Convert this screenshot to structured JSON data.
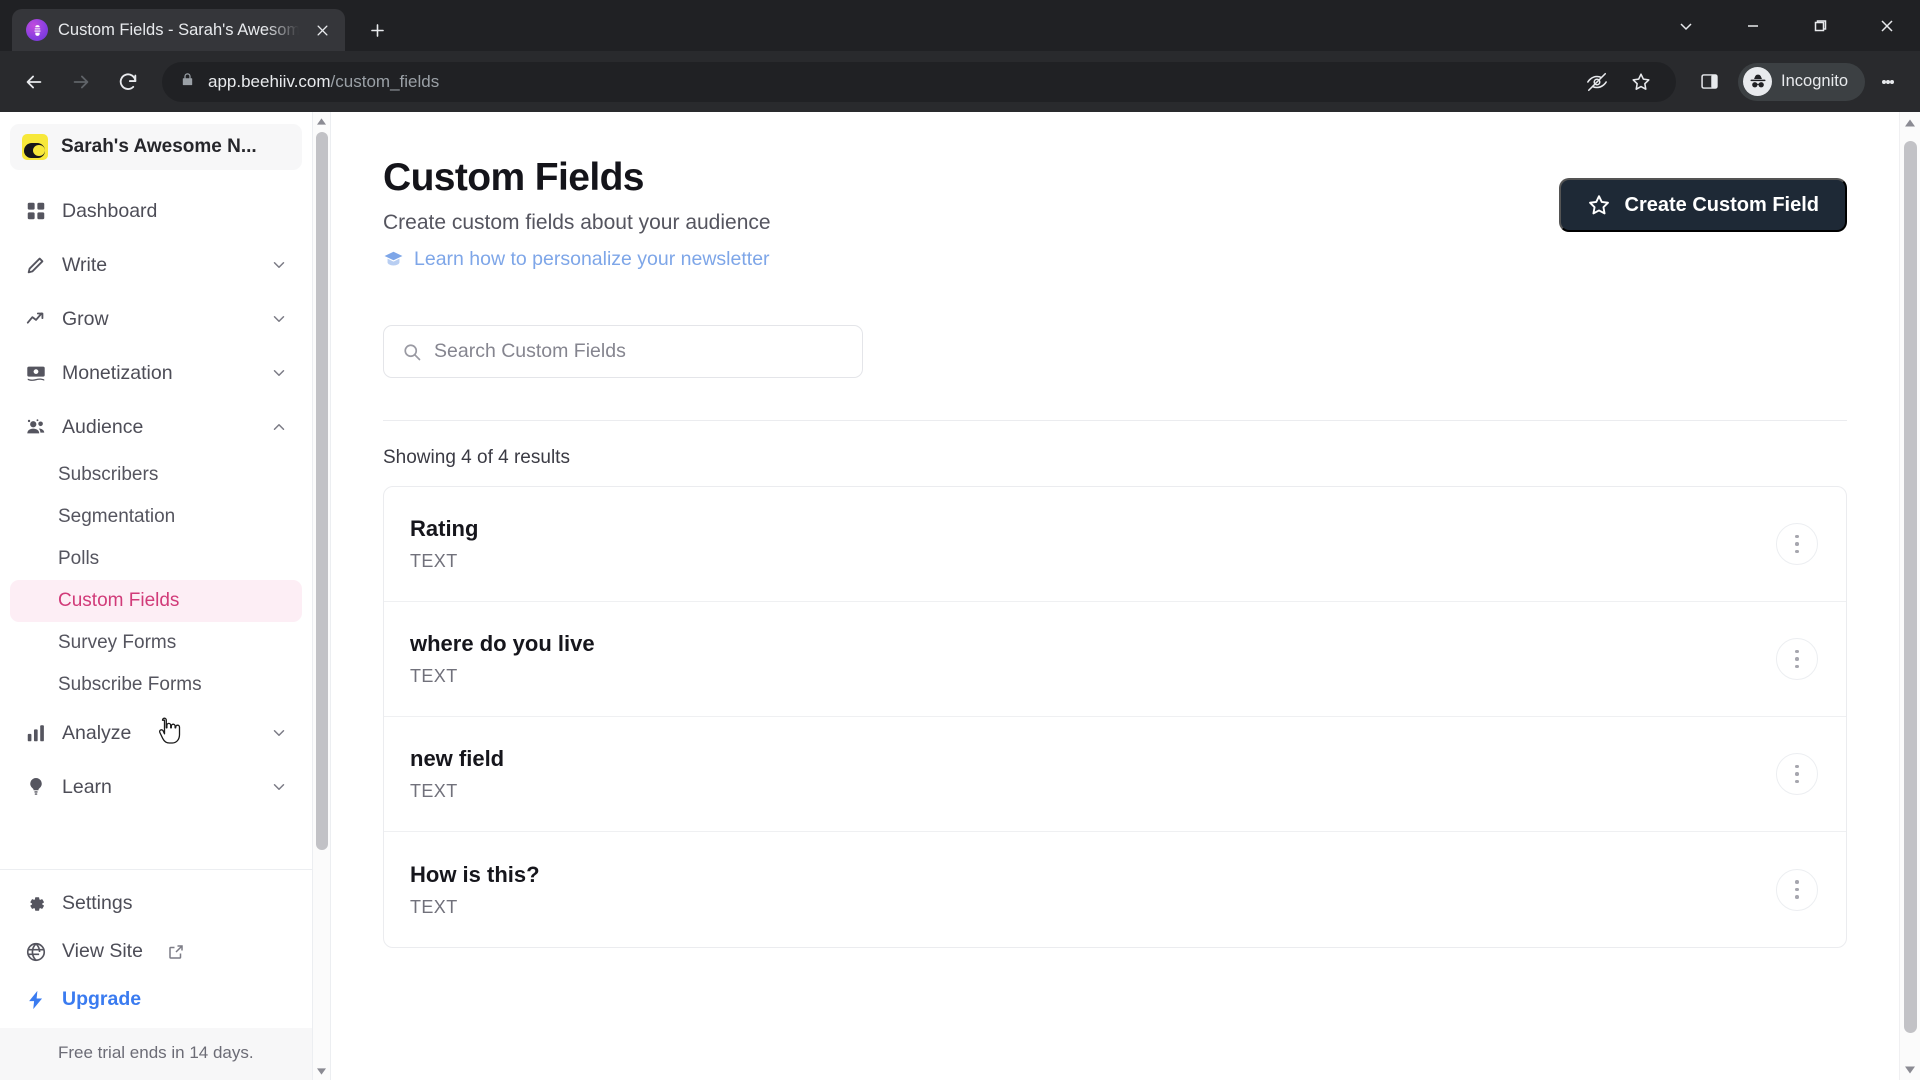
{
  "browser": {
    "tab": {
      "title": "Custom Fields - Sarah's Awesom",
      "favicon_name": "beehiiv-favicon",
      "close_label": "Close tab"
    },
    "new_tab_label": "New Tab",
    "window_controls": [
      "chevron-down",
      "minimize",
      "maximize",
      "close"
    ],
    "nav": {
      "back": "Back",
      "forward": "Forward",
      "reload": "Reload"
    },
    "omnibox": {
      "lock": "site-information",
      "url_host": "app.beehiiv.com",
      "url_path": "/custom_fields",
      "full_url": "app.beehiiv.com/custom_fields"
    },
    "toolbar_icons": [
      "third-party-cookie-blocked",
      "bookmark-star",
      "side-panel"
    ],
    "profile": {
      "label": "Incognito",
      "icon": "incognito-hat-glasses"
    },
    "menu_label": "Customize and control Google Chrome"
  },
  "sidebar": {
    "brand": {
      "name": "Sarah's Awesome N...",
      "logo": "beehiiv-logo"
    },
    "items": [
      {
        "label": "Dashboard",
        "icon": "grid-icon",
        "expandable": false
      },
      {
        "label": "Write",
        "icon": "pencil-icon",
        "expandable": true,
        "expanded": false
      },
      {
        "label": "Grow",
        "icon": "trend-up-icon",
        "expandable": true,
        "expanded": false
      },
      {
        "label": "Monetization",
        "icon": "money-icon",
        "expandable": true,
        "expanded": false
      },
      {
        "label": "Audience",
        "icon": "people-icon",
        "expandable": true,
        "expanded": true
      }
    ],
    "audience_children": [
      {
        "label": "Subscribers",
        "active": false
      },
      {
        "label": "Segmentation",
        "active": false
      },
      {
        "label": "Polls",
        "active": false
      },
      {
        "label": "Custom Fields",
        "active": true
      },
      {
        "label": "Survey Forms",
        "active": false
      },
      {
        "label": "Subscribe Forms",
        "active": false
      }
    ],
    "items_after": [
      {
        "label": "Analyze",
        "icon": "bar-chart-icon",
        "expandable": true,
        "expanded": false
      },
      {
        "label": "Learn",
        "icon": "lightbulb-icon",
        "expandable": true,
        "expanded": false
      }
    ],
    "footer": [
      {
        "label": "Settings",
        "icon": "gear-icon",
        "external": false,
        "accent": false
      },
      {
        "label": "View Site",
        "icon": "globe-icon",
        "external": true,
        "accent": false
      },
      {
        "label": "Upgrade",
        "icon": "lightning-icon",
        "external": false,
        "accent": true
      }
    ],
    "trial_notice": "Free trial ends in 14 days.",
    "active_color": "#d13b79",
    "active_bg": "#fdeef5",
    "upgrade_color": "#3a7bf0"
  },
  "main": {
    "title": "Custom Fields",
    "subtitle": "Create custom fields about your audience",
    "learn_link": "Learn how to personalize your newsletter",
    "learn_link_color": "#7ea6e8",
    "create_button": "Create Custom Field",
    "create_button_bg": "#1e2936",
    "search": {
      "placeholder": "Search Custom Fields",
      "value": ""
    },
    "results_count": "Showing 4 of 4 results",
    "fields": [
      {
        "name": "Rating",
        "type": "TEXT"
      },
      {
        "name": "where do you live",
        "type": "TEXT"
      },
      {
        "name": "new field",
        "type": "TEXT"
      },
      {
        "name": "How is this?",
        "type": "TEXT"
      }
    ],
    "row_menu_label": "Row actions"
  }
}
